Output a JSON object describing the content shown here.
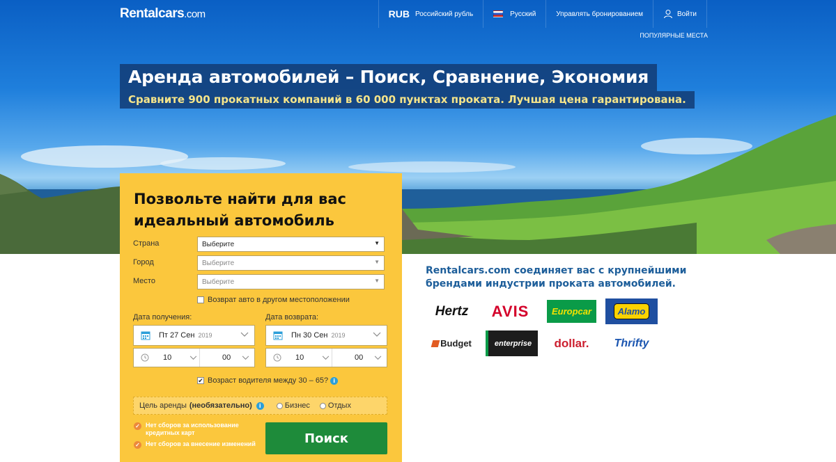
{
  "header": {
    "logo_main": "Rentalcars",
    "logo_domain": ".com",
    "currency_code": "RUB",
    "currency_name": "Российский рубль",
    "language": "Русский",
    "manage_booking": "Управлять бронированием",
    "sign_in": "Войти",
    "popular_places": "ПОПУЛЯРНЫЕ МЕСТА"
  },
  "hero": {
    "title": "Аренда автомобилей – Поиск, Сравнение, Экономия",
    "subtitle": "Сравните 900 прокатных компаний в 60 000 пунктах проката. Лучшая цена гарантирована."
  },
  "search": {
    "title": "Позвольте найти для вас идеальный автомобиль",
    "country_label": "Страна",
    "country_value": "Выберите",
    "city_label": "Город",
    "city_value": "Выберите",
    "place_label": "Место",
    "place_value": "Выберите",
    "return_other": "Возврат авто в другом местоположении",
    "pickup_label": "Дата получения:",
    "pickup_date": "Пт 27 Сен",
    "pickup_year": "2019",
    "pickup_hour": "10",
    "pickup_min": "00",
    "return_label": "Дата возврата:",
    "return_date": "Пн 30 Сен",
    "return_year": "2019",
    "return_hour": "10",
    "return_min": "00",
    "driver_age": "Возраст водителя между 30 – 65?",
    "purpose_label": "Цель аренды",
    "purpose_optional": "(необязательно)",
    "purpose_business": "Бизнес",
    "purpose_leisure": "Отдых",
    "perk_1": "Нет сборов за использование кредитных карт",
    "perk_2": "Нет сборов за внесение изменений",
    "search_button": "Поиск"
  },
  "promo": {
    "text": "Rentalcars.com соединяет вас с крупнейшими брендами индустрии проката автомобилей."
  },
  "brands": {
    "hertz": "Hertz",
    "avis": "AVIS",
    "europcar": "Europcar",
    "alamo": "Alamo",
    "budget": "Budget",
    "enterprise": "enterprise",
    "dollar": "dollar.",
    "thrifty": "Thrifty"
  },
  "colors": {
    "header_blue": "#0a5fc4",
    "panel_yellow": "#fbc73d",
    "search_green": "#1e8b3a",
    "promo_blue": "#1d5e9a",
    "subtitle_yellow": "#f6e58a"
  }
}
